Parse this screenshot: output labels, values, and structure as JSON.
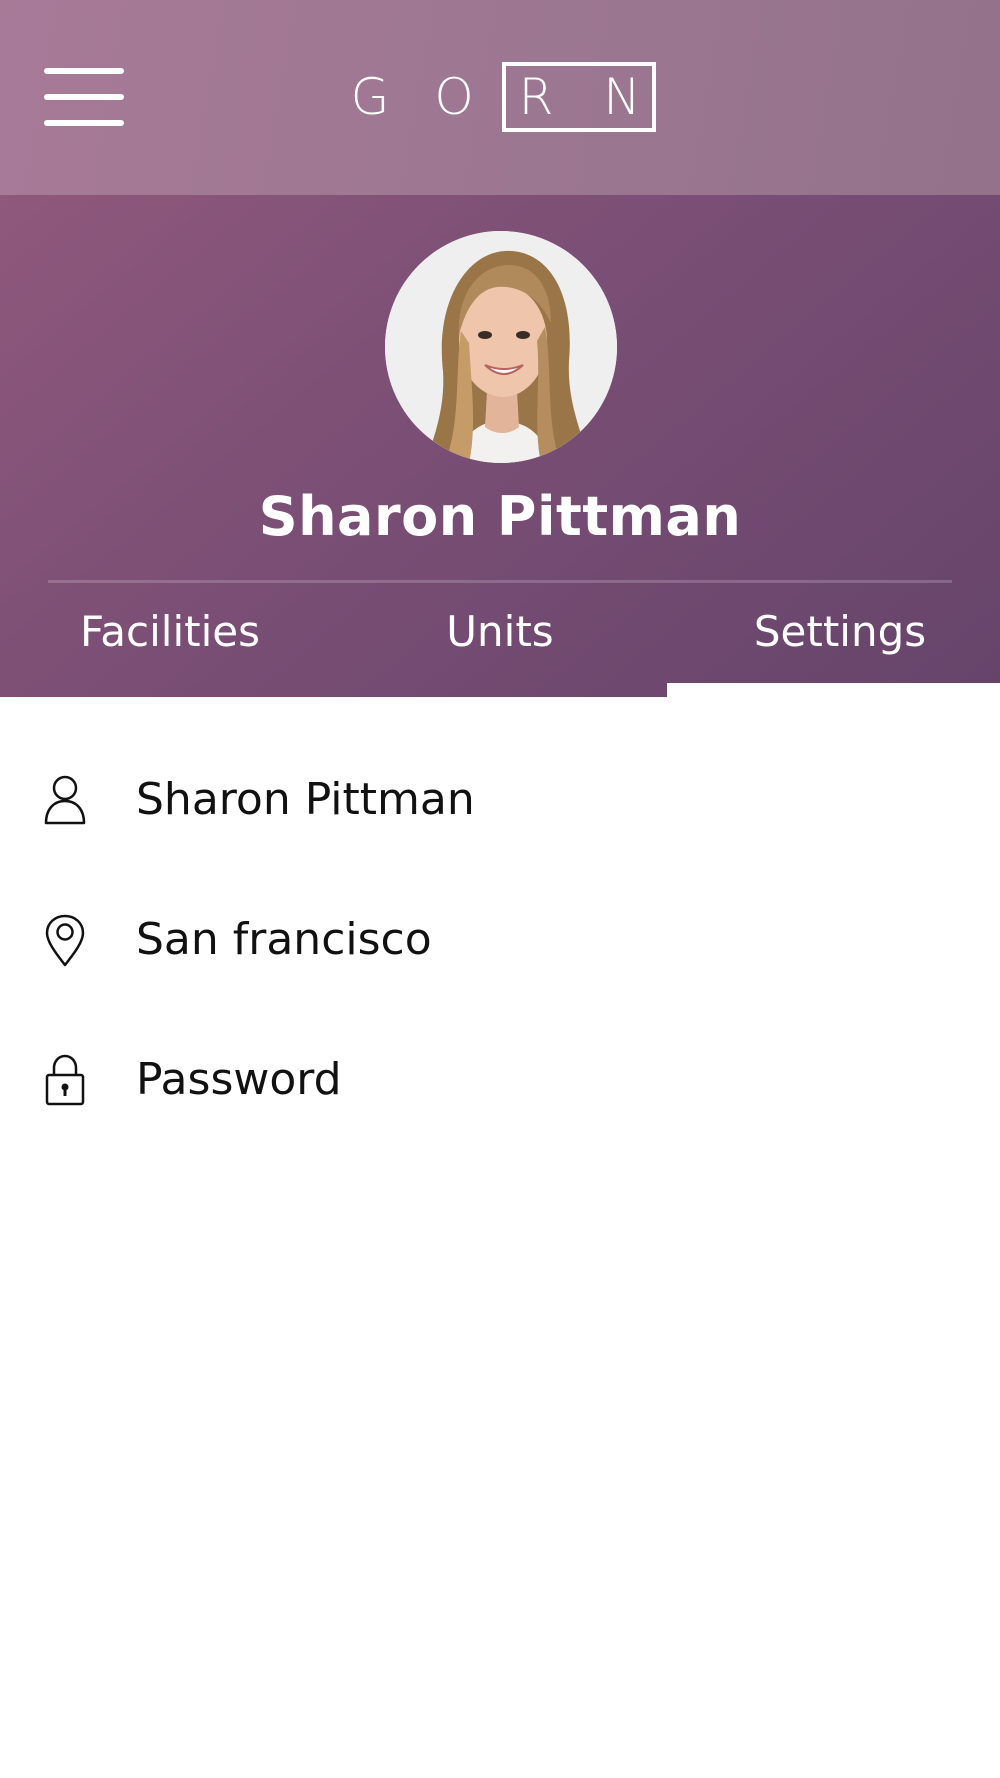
{
  "header": {
    "menu_icon": "hamburger-menu-icon",
    "logo_letters": [
      "G",
      "O",
      "R",
      "N"
    ]
  },
  "profile": {
    "name": "Sharon Pittman",
    "avatar": "profile-photo"
  },
  "tabs": [
    {
      "label": "Facilities",
      "active": false
    },
    {
      "label": "Units",
      "active": false
    },
    {
      "label": "Settings",
      "active": true
    }
  ],
  "settings": [
    {
      "icon": "user-icon",
      "label": "Sharon Pittman"
    },
    {
      "icon": "location-pin-icon",
      "label": "San francisco"
    },
    {
      "icon": "lock-icon",
      "label": "Password"
    }
  ],
  "colors": {
    "header": "#9c7791",
    "hero_start": "#8f587c",
    "hero_end": "#66446a",
    "text_light": "#ffffff",
    "text_dark": "#111111"
  }
}
